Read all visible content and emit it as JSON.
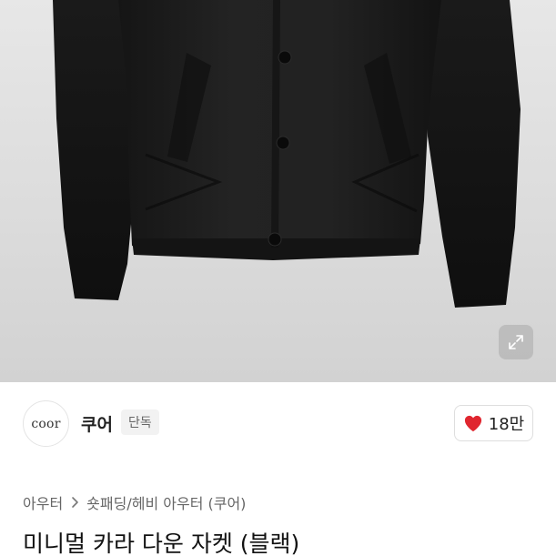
{
  "product_image": {
    "alt": "",
    "expand_icon": "expand-icon"
  },
  "brand": {
    "logo_text": "coor",
    "name": "쿠어",
    "badge": "단독"
  },
  "like": {
    "icon": "heart-icon",
    "icon_color": "#e0262f",
    "count": "18만"
  },
  "breadcrumb": {
    "items": [
      "아우터",
      "숏패딩/헤비 아우터 (쿠어)"
    ],
    "separator_icon": "chevron-right-icon"
  },
  "product": {
    "title": "미니멀 카라 다운 자켓 (블랙)"
  }
}
